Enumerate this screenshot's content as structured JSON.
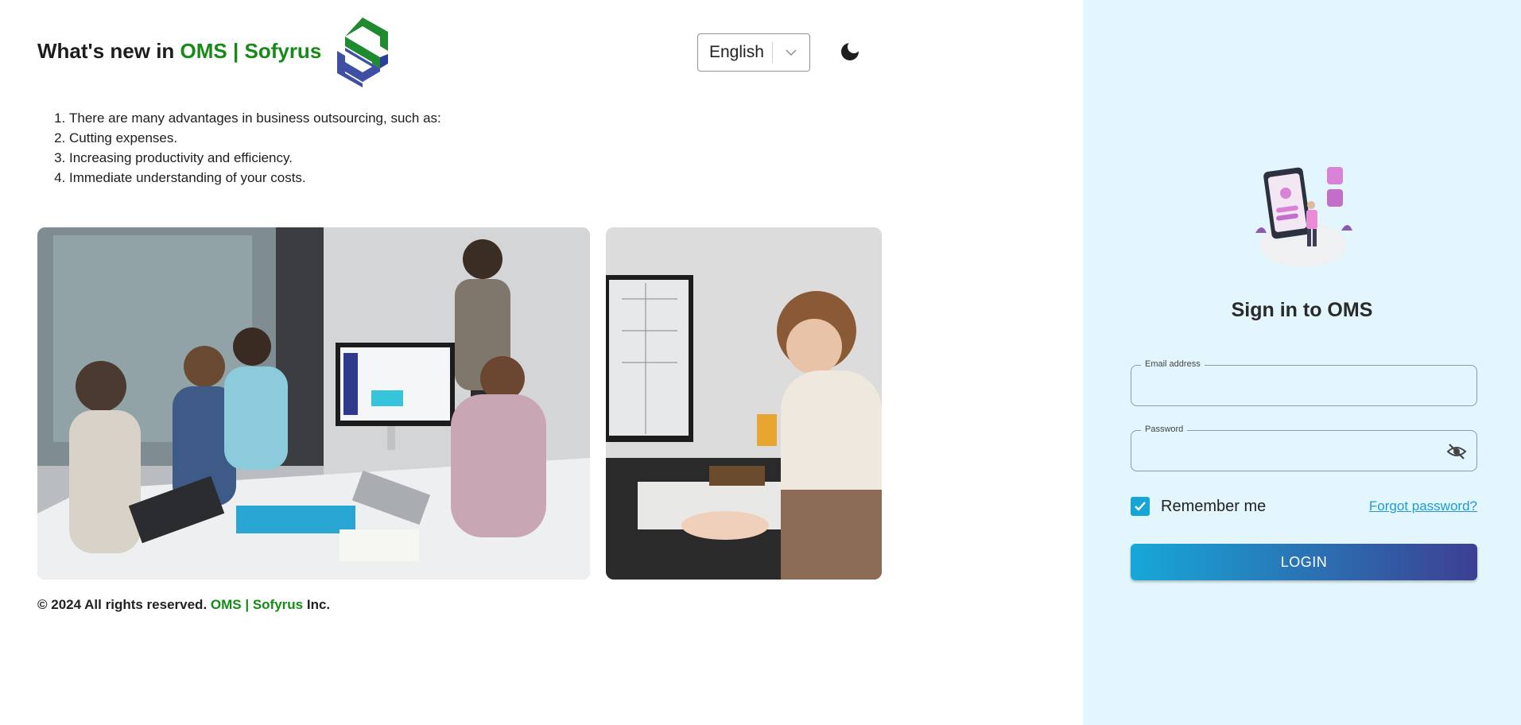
{
  "header": {
    "title_prefix": "What's new in ",
    "brand": "OMS | Sofyrus"
  },
  "language_select": {
    "selected": "English"
  },
  "theme_toggle": {
    "icon": "moon-icon"
  },
  "features": [
    "There are many advantages in business outsourcing, such as:",
    "Cutting expenses.",
    "Increasing productivity and efficiency.",
    "Immediate understanding of your costs."
  ],
  "footer": {
    "prefix": "© 2024 All rights reserved. ",
    "brand": "OMS | Sofyrus",
    "suffix": " Inc."
  },
  "signin": {
    "title": "Sign in to OMS",
    "email_label": "Email address",
    "email_value": "",
    "password_label": "Password",
    "password_value": "",
    "remember_label": "Remember me",
    "remember_checked": true,
    "forgot_label": "Forgot password?",
    "login_label": "LOGIN"
  },
  "colors": {
    "brand_green": "#168a16",
    "accent_blue": "#17a4d6",
    "right_panel_bg": "#e3f6fd",
    "button_gradient_start": "#17a8d8",
    "button_gradient_end": "#3d3f91"
  }
}
